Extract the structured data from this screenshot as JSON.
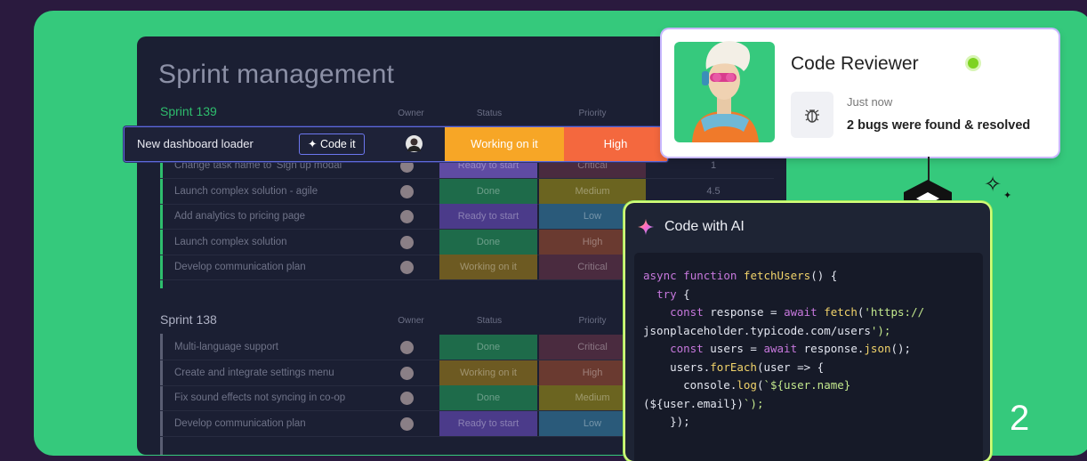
{
  "board": {
    "title": "Sprint management",
    "sprints": [
      {
        "name": "Sprint 139",
        "color": "#2ebd6d",
        "headers": {
          "owner": "Owner",
          "status": "Status",
          "priority": "Priority"
        },
        "rows": [
          {
            "name": "Change task name to 'Sign up modal'",
            "status": "Ready to start",
            "status_color": "#5f4ba3",
            "priority": "Critical",
            "priority_color": "#4a2b3f",
            "num": "1"
          },
          {
            "name": "Launch complex solution - agile",
            "status": "Done",
            "status_color": "#1e6b4a",
            "priority": "Medium",
            "priority_color": "#6b6420",
            "num": "4.5"
          },
          {
            "name": "Add analytics to pricing page",
            "status": "Ready to start",
            "status_color": "#4b3b8a",
            "priority": "Low",
            "priority_color": "#2a5a7a",
            "num": ""
          },
          {
            "name": "Launch complex solution",
            "status": "Done",
            "status_color": "#1e6b4a",
            "priority": "High",
            "priority_color": "#6a3a30",
            "num": ""
          },
          {
            "name": "Develop communication plan",
            "status": "Working on it",
            "status_color": "#6d5a22",
            "priority": "Critical",
            "priority_color": "#4a2b3f",
            "num": ""
          }
        ]
      },
      {
        "name": "Sprint 138",
        "color": "#8c90a6",
        "headers": {
          "owner": "Owner",
          "status": "Status",
          "priority": "Priority"
        },
        "rows": [
          {
            "name": "Multi-language support",
            "status": "Done",
            "status_color": "#1e6b4a",
            "priority": "Critical",
            "priority_color": "#4a2b3f",
            "num": ""
          },
          {
            "name": "Create and integrate settings menu",
            "status": "Working on it",
            "status_color": "#6d5a22",
            "priority": "High",
            "priority_color": "#6a3a30",
            "num": ""
          },
          {
            "name": "Fix sound effects not syncing in co-op",
            "status": "Done",
            "status_color": "#1e6b4a",
            "priority": "Medium",
            "priority_color": "#6b6420",
            "num": ""
          },
          {
            "name": "Develop communication plan",
            "status": "Ready to start",
            "status_color": "#4b3b8a",
            "priority": "Low",
            "priority_color": "#2a5a7a",
            "num": ""
          }
        ]
      }
    ]
  },
  "highlight_row": {
    "name": "New dashboard loader",
    "action_label": "Code it",
    "status": "Working on it",
    "priority": "High"
  },
  "reviewer_card": {
    "title": "Code Reviewer",
    "time": "Just now",
    "message": "2 bugs were found & resolved",
    "icon": "bug-icon"
  },
  "ai_card": {
    "title": "Code with AI",
    "code_lines": [
      "async function fetchUsers() {",
      "  try {",
      "    const response = await fetch('https://",
      "jsonplaceholder.typicode.com/users');",
      "    const users = await response.json();",
      "    users.forEach(user => {",
      "      console.log(`${user.name}",
      "(${user.email})`);",
      "    });"
    ]
  },
  "page_number": "2"
}
